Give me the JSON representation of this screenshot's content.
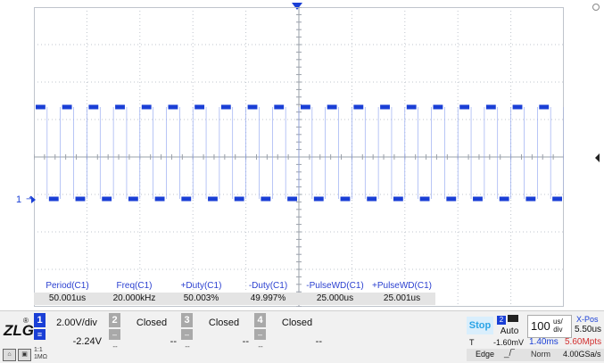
{
  "colors": {
    "trace": "#1a3fd6",
    "grid": "#bfc4cc",
    "accent": "#2aa4e6",
    "mem": "#d23030"
  },
  "channel_marker": {
    "label": "1",
    "arrow": "⬏"
  },
  "measurements": [
    {
      "name": "Period(C1)",
      "value": "50.001us"
    },
    {
      "name": "Freq(C1)",
      "value": "20.000kHz"
    },
    {
      "name": "+Duty(C1)",
      "value": "50.003%"
    },
    {
      "name": "-Duty(C1)",
      "value": "49.997%"
    },
    {
      "name": "-PulseWD(C1)",
      "value": "25.000us"
    },
    {
      "name": "+PulseWD(C1)",
      "value": "25.001us"
    }
  ],
  "waveform": {
    "cycles_shown": 20,
    "duty": 0.5,
    "time_div_us": 100
  },
  "logo": {
    "text": "ZLG",
    "reg": "®"
  },
  "impedance": {
    "line1": "1:1",
    "line2": "1MΩ"
  },
  "channels": [
    {
      "num": "1",
      "main": "2.00V/div",
      "secondary": "-2.24V",
      "sub": "≡",
      "color": "#1a3fd6"
    },
    {
      "num": "2",
      "main": "Closed",
      "secondary": "--",
      "dash": "--",
      "color": "#a9a9a9"
    },
    {
      "num": "3",
      "main": "Closed",
      "secondary": "--",
      "dash": "--",
      "color": "#a9a9a9"
    },
    {
      "num": "4",
      "main": "Closed",
      "secondary": "--",
      "dash": "--",
      "color": "#a9a9a9"
    }
  ],
  "acquisition": {
    "state": "Stop",
    "trigger_source": "2",
    "trigger_mode": "Auto",
    "timebase_value": "100",
    "timebase_unit_top": "us/",
    "timebase_unit_bottom": "div",
    "xpos_label": "X-Pos",
    "xpos_value": "5.50us",
    "trigger_label": "T",
    "trigger_level": "-1.60mV",
    "delay": "1.40ms",
    "memory": "5.60Mpts",
    "edge_label": "Edge",
    "edge_icon": "_/‾",
    "norm_label": "Norm",
    "sample_rate": "4.00GSa/s"
  }
}
